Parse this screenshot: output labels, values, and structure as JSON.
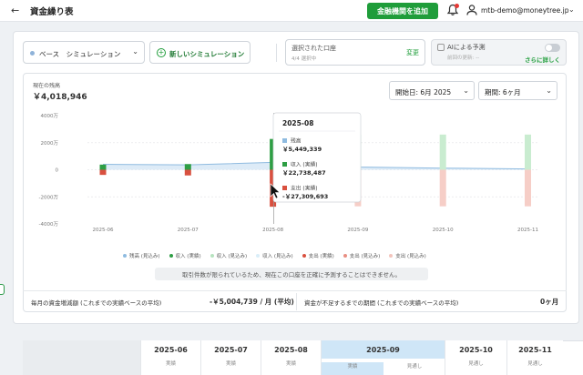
{
  "header": {
    "back_icon": "arrow-left-icon",
    "title": "資金繰り表",
    "add_institution_label": "金融機関を追加",
    "notification_icon": "bell-icon",
    "user_icon": "user-icon",
    "user_email": "mtb-demo@moneytree.jp",
    "user_chevron": "⌄"
  },
  "toolbar": {
    "simulation_select": "ベース　シミュレーション",
    "simulation_chevron": "⌄",
    "new_simulation_label": "新しいシミュレーション",
    "new_simulation_icon": "+",
    "account_title": "選択された口座",
    "account_sub": "4/4 選択中",
    "account_change": "変更",
    "ai_title": "AIによる予測",
    "ai_sub": "前回の更新: --",
    "ai_more": "さらに詳しく",
    "ai_toggle_on": false
  },
  "summary": {
    "balance_label": "現在の残高",
    "balance_value": "￥4,018,946",
    "start_select": "開始日: 6月 2025",
    "period_select": "期間: 6ヶ月",
    "select_chevron": "⌄"
  },
  "chart_data": {
    "type": "bar",
    "y_ticks": [
      "4000万",
      "2000万",
      "0",
      "-2000万",
      "-4000万"
    ],
    "ylim": [
      -40000000,
      40000000
    ],
    "categories": [
      "2025-06",
      "2025-07",
      "2025-08",
      "2025-09",
      "2025-10",
      "2025-11"
    ],
    "series": [
      {
        "name": "残高 (見込み)",
        "color": "#a9c8e6",
        "values": [
          4018946,
          3600000,
          5449339,
          2000000,
          1200000,
          600000
        ]
      },
      {
        "name": "収入 (実績)",
        "color": "#2e9e44",
        "values": [
          3800000,
          4200000,
          22738487,
          0,
          0,
          0
        ]
      },
      {
        "name": "収入 (見込み)",
        "color": "#c9ecd0",
        "values": [
          0,
          0,
          0,
          26000000,
          26000000,
          26000000
        ]
      },
      {
        "name": "支出 (実績)",
        "color": "#d9503f",
        "values": [
          -3800000,
          -4200000,
          -27309693,
          0,
          0,
          0
        ]
      },
      {
        "name": "支出 (見込み)",
        "color": "#f6cec7",
        "values": [
          0,
          0,
          0,
          -27000000,
          -27000000,
          -27000000
        ]
      }
    ],
    "tooltip": {
      "title": "2025-08",
      "rows": [
        {
          "label": "残高",
          "value": "￥5,449,339",
          "color": "#8fbbe0"
        },
        {
          "label": "収入 (実績)",
          "value": "￥22,738,487",
          "color": "#2e9e44"
        },
        {
          "label": "支出 (実績)",
          "value": "-￥27,309,693",
          "color": "#d9503f"
        }
      ]
    }
  },
  "legend": [
    {
      "label": "残高 (見込み)",
      "color": "#8fbbe0"
    },
    {
      "label": "収入 (実績)",
      "color": "#2e9e44"
    },
    {
      "label": "収入 (見込み)",
      "color": "#b6e3bf"
    },
    {
      "label": "収入 (見込み)",
      "color": "#d9eef9"
    },
    {
      "label": "支出 (実績)",
      "color": "#d9503f"
    },
    {
      "label": "支出 (見込み)",
      "color": "#e88f82"
    },
    {
      "label": "支出 (見込み)",
      "color": "#f3c4bc"
    }
  ],
  "notice": "取引件数が限られているため、現在この口座を正確に予測することはできません。",
  "stats": {
    "monthly_change_label": "毎月の資金増減額 (これまでの実績ベースの平均)",
    "monthly_change_value": "-￥5,004,739 / 月 (平均)",
    "shortfall_label": "資金が不足するまでの期間 (これまでの実績ベースの平均)",
    "shortfall_value": "0ヶ月"
  },
  "table": {
    "months": [
      {
        "name": "2025-06",
        "sub": "実績"
      },
      {
        "name": "2025-07",
        "sub": "実績"
      },
      {
        "name": "2025-08",
        "sub": "実績"
      },
      {
        "name": "2025-09",
        "sub_a": "実績",
        "sub_b": "見通し"
      },
      {
        "name": "2025-10",
        "sub": "見通し"
      },
      {
        "name": "2025-11",
        "sub": "見通し"
      }
    ]
  }
}
